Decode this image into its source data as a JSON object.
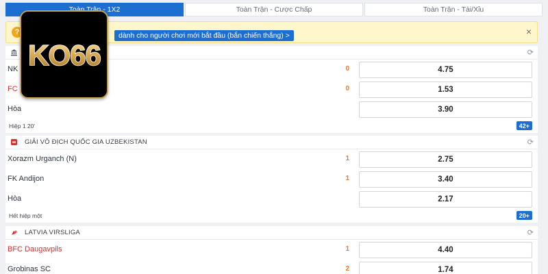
{
  "tabs": [
    {
      "label": "Toàn Trận - 1X2",
      "active": true
    },
    {
      "label": "Toàn Trận - Cược Chấp",
      "active": false
    },
    {
      "label": "Toàn Trận - Tài/Xỉu",
      "active": false
    }
  ],
  "notice": {
    "help_icon": "?",
    "link_text": "dành cho người chơi mới bắt đầu (bắn chiến thắng) >",
    "close_icon": "×"
  },
  "logo": {
    "text": "KO66"
  },
  "sections": [
    {
      "league": "",
      "icon": "bank-icon",
      "rows": [
        {
          "team": "NK",
          "red": false,
          "score": "0",
          "odd": "4.75"
        },
        {
          "team": "FC",
          "red": true,
          "score": "0",
          "odd": "1.53"
        },
        {
          "team": "Hòa",
          "red": false,
          "score": "",
          "odd": "3.90"
        }
      ],
      "status": "Hiệp 1 20'",
      "more": "42+"
    },
    {
      "league": "GIẢI VÔ ĐỊCH QUỐC GIA UZBEKISTAN",
      "icon": "flag-icon",
      "rows": [
        {
          "team": "Xorazm Urganch (N)",
          "red": false,
          "score": "1",
          "odd": "2.75"
        },
        {
          "team": "FK Andijon",
          "red": false,
          "score": "1",
          "odd": "3.40"
        },
        {
          "team": "Hòa",
          "red": false,
          "score": "",
          "odd": "2.17"
        }
      ],
      "status": "Hết hiệp một",
      "more": "20+"
    },
    {
      "league": "LATVIA VIRSLIGA",
      "icon": "flag-icon",
      "rows": [
        {
          "team": "BFC Daugavpils",
          "red": true,
          "score": "1",
          "odd": "4.40"
        },
        {
          "team": "Grobinas SC",
          "red": false,
          "score": "2",
          "odd": "1.74"
        }
      ]
    }
  ],
  "colors": {
    "primary": "#1c6fd1",
    "score": "#e8792c",
    "team_red": "#d22d2d",
    "notice_bg": "#fff6cc",
    "logo_gold": "#c8a04a"
  }
}
